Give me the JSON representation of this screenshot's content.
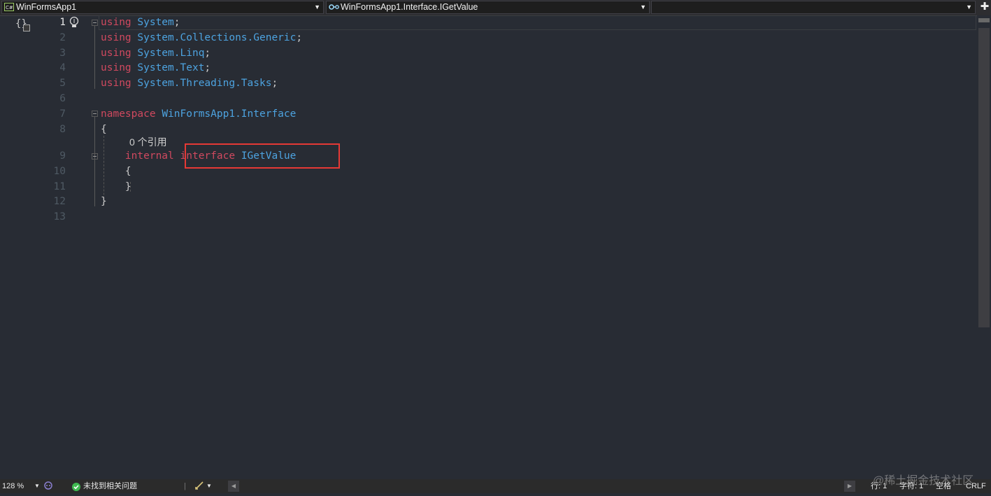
{
  "navbar": {
    "project": "WinFormsApp1",
    "type_scope": "WinFormsApp1.Interface.IGetValue",
    "member": ""
  },
  "editor": {
    "line_numbers": [
      "1",
      "2",
      "3",
      "4",
      "5",
      "6",
      "7",
      "8",
      "9",
      "10",
      "11",
      "12",
      "13"
    ],
    "lines": [
      {
        "kw": "using",
        "ns": "System",
        "end": ";"
      },
      {
        "kw": "using",
        "ns": "System.Collections.Generic",
        "end": ";"
      },
      {
        "kw": "using",
        "ns": "System.Linq",
        "end": ";"
      },
      {
        "kw": "using",
        "ns": "System.Text",
        "end": ";"
      },
      {
        "kw": "using",
        "ns": "System.Threading.Tasks",
        "end": ";"
      }
    ],
    "namespace_kw": "namespace",
    "namespace_name": "WinFormsApp1.Interface",
    "open_brace": "{",
    "close_brace": "}",
    "codelens": "0 个引用",
    "modifier": "internal",
    "interface_kw": "interface",
    "interface_name": "IGetValue",
    "inner_open": "{",
    "inner_close": "}"
  },
  "statusbar": {
    "zoom": "128 %",
    "issues": "未找到相关问题",
    "line": "行: 1",
    "char": "字符: 1",
    "whitespace": "空格",
    "eol": "CRLF"
  },
  "watermark": "@稀土掘金技术社区",
  "colors": {
    "background": "#282c34",
    "keyword": "#d0495f",
    "type": "#4da3e0",
    "highlight_box": "#e53935"
  }
}
